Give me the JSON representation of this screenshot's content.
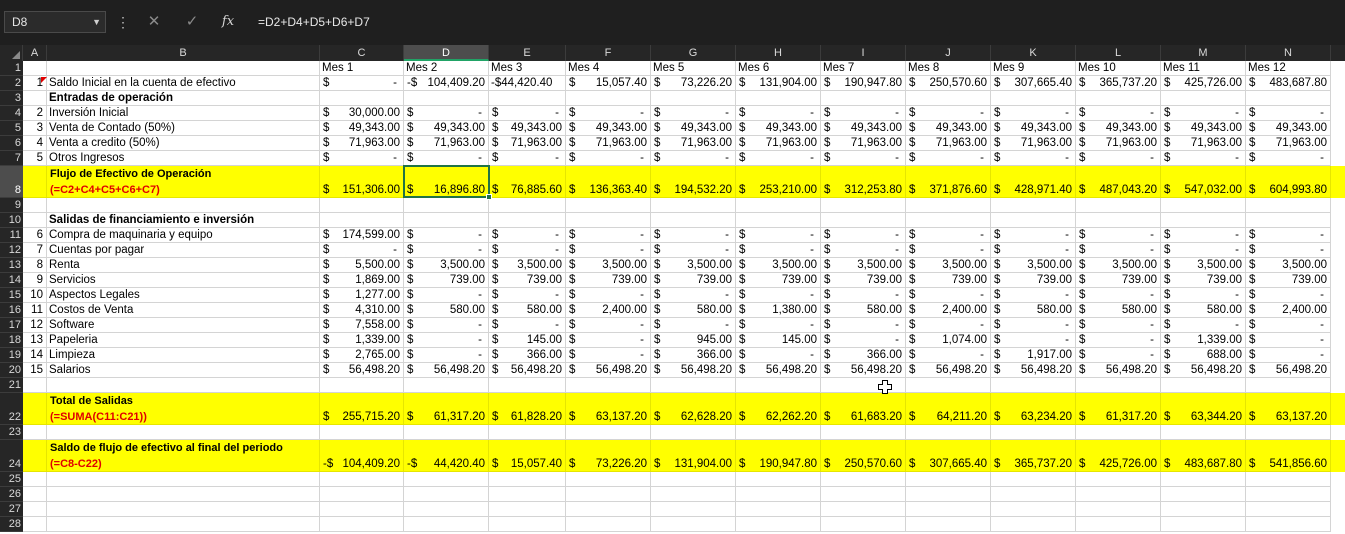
{
  "formula_bar": {
    "name_box": "D8",
    "formula": "=D2+D4+D5+D6+D7"
  },
  "columns": [
    "A",
    "B",
    "C",
    "D",
    "E",
    "F",
    "G",
    "H",
    "I",
    "J",
    "K",
    "L",
    "M",
    "N"
  ],
  "selected_cell": "D8",
  "rows": [
    {
      "n": 1,
      "a": "",
      "b": "",
      "style": "",
      "vals": [
        [
          "",
          "Mes 1"
        ],
        [
          "",
          "Mes 2"
        ],
        [
          "",
          "Mes 3"
        ],
        [
          "",
          "Mes 4"
        ],
        [
          "",
          "Mes 5"
        ],
        [
          "",
          "Mes 6"
        ],
        [
          "",
          "Mes 7"
        ],
        [
          "",
          "Mes 8"
        ],
        [
          "",
          "Mes 9"
        ],
        [
          "",
          "Mes 10"
        ],
        [
          "",
          "Mes 11"
        ],
        [
          "",
          "Mes 12"
        ]
      ]
    },
    {
      "n": 2,
      "a": "1",
      "b": "Saldo Inicial en la cuenta de efectivo",
      "style": "",
      "vals": [
        [
          "$",
          "-"
        ],
        [
          "-$",
          "104,409.20"
        ],
        [
          "-$",
          "44,420.40"
        ],
        [
          "$",
          "15,057.40"
        ],
        [
          "$",
          "73,226.20"
        ],
        [
          "$",
          "131,904.00"
        ],
        [
          "$",
          "190,947.80"
        ],
        [
          "$",
          "250,570.60"
        ],
        [
          "$",
          "307,665.40"
        ],
        [
          "$",
          "365,737.20"
        ],
        [
          "$",
          "425,726.00"
        ],
        [
          "$",
          "483,687.80"
        ]
      ]
    },
    {
      "n": 3,
      "a": "",
      "b": "Entradas de operación",
      "style": "bold",
      "vals": []
    },
    {
      "n": 4,
      "a": "2",
      "b": "Inversión Inicial",
      "style": "",
      "vals": [
        [
          "$",
          "30,000.00"
        ],
        [
          "$",
          "-"
        ],
        [
          "$",
          "-"
        ],
        [
          "$",
          "-"
        ],
        [
          "$",
          "-"
        ],
        [
          "$",
          "-"
        ],
        [
          "$",
          "-"
        ],
        [
          "$",
          "-"
        ],
        [
          "$",
          "-"
        ],
        [
          "$",
          "-"
        ],
        [
          "$",
          "-"
        ],
        [
          "$",
          "-"
        ]
      ]
    },
    {
      "n": 5,
      "a": "3",
      "b": "Venta de Contado (50%)",
      "style": "",
      "vals": [
        [
          "$",
          "49,343.00"
        ],
        [
          "$",
          "49,343.00"
        ],
        [
          "$",
          "49,343.00"
        ],
        [
          "$",
          "49,343.00"
        ],
        [
          "$",
          "49,343.00"
        ],
        [
          "$",
          "49,343.00"
        ],
        [
          "$",
          "49,343.00"
        ],
        [
          "$",
          "49,343.00"
        ],
        [
          "$",
          "49,343.00"
        ],
        [
          "$",
          "49,343.00"
        ],
        [
          "$",
          "49,343.00"
        ],
        [
          "$",
          "49,343.00"
        ]
      ]
    },
    {
      "n": 6,
      "a": "4",
      "b": "Venta a credito (50%)",
      "style": "",
      "vals": [
        [
          "$",
          "71,963.00"
        ],
        [
          "$",
          "71,963.00"
        ],
        [
          "$",
          "71,963.00"
        ],
        [
          "$",
          "71,963.00"
        ],
        [
          "$",
          "71,963.00"
        ],
        [
          "$",
          "71,963.00"
        ],
        [
          "$",
          "71,963.00"
        ],
        [
          "$",
          "71,963.00"
        ],
        [
          "$",
          "71,963.00"
        ],
        [
          "$",
          "71,963.00"
        ],
        [
          "$",
          "71,963.00"
        ],
        [
          "$",
          "71,963.00"
        ]
      ]
    },
    {
      "n": 7,
      "a": "5",
      "b": "Otros Ingresos",
      "style": "",
      "vals": [
        [
          "$",
          "-"
        ],
        [
          "$",
          "-"
        ],
        [
          "$",
          "-"
        ],
        [
          "$",
          "-"
        ],
        [
          "$",
          "-"
        ],
        [
          "$",
          "-"
        ],
        [
          "$",
          "-"
        ],
        [
          "$",
          "-"
        ],
        [
          "$",
          "-"
        ],
        [
          "$",
          "-"
        ],
        [
          "$",
          "-"
        ],
        [
          "$",
          "-"
        ]
      ]
    },
    {
      "n": 8,
      "a": "",
      "b": "Flujo de Efectivo de Operación",
      "b2": "(=C2+C4+C5+C6+C7)",
      "style": "yellow",
      "vals": [
        [
          "$",
          "151,306.00"
        ],
        [
          "$",
          "16,896.80"
        ],
        [
          "$",
          "76,885.60"
        ],
        [
          "$",
          "136,363.40"
        ],
        [
          "$",
          "194,532.20"
        ],
        [
          "$",
          "253,210.00"
        ],
        [
          "$",
          "312,253.80"
        ],
        [
          "$",
          "371,876.60"
        ],
        [
          "$",
          "428,971.40"
        ],
        [
          "$",
          "487,043.20"
        ],
        [
          "$",
          "547,032.00"
        ],
        [
          "$",
          "604,993.80"
        ]
      ]
    },
    {
      "n": 9,
      "a": "",
      "b": "",
      "style": "",
      "vals": []
    },
    {
      "n": 10,
      "a": "",
      "b": "Salidas de financiamiento e inversión",
      "style": "bold",
      "vals": []
    },
    {
      "n": 11,
      "a": "6",
      "b": "Compra de maquinaria y equipo",
      "style": "",
      "vals": [
        [
          "$",
          "174,599.00"
        ],
        [
          "$",
          "-"
        ],
        [
          "$",
          "-"
        ],
        [
          "$",
          "-"
        ],
        [
          "$",
          "-"
        ],
        [
          "$",
          "-"
        ],
        [
          "$",
          "-"
        ],
        [
          "$",
          "-"
        ],
        [
          "$",
          "-"
        ],
        [
          "$",
          "-"
        ],
        [
          "$",
          "-"
        ],
        [
          "$",
          "-"
        ]
      ]
    },
    {
      "n": 12,
      "a": "7",
      "b": "Cuentas por pagar",
      "style": "",
      "vals": [
        [
          "$",
          "-"
        ],
        [
          "$",
          "-"
        ],
        [
          "$",
          "-"
        ],
        [
          "$",
          "-"
        ],
        [
          "$",
          "-"
        ],
        [
          "$",
          "-"
        ],
        [
          "$",
          "-"
        ],
        [
          "$",
          "-"
        ],
        [
          "$",
          "-"
        ],
        [
          "$",
          "-"
        ],
        [
          "$",
          "-"
        ],
        [
          "$",
          "-"
        ]
      ]
    },
    {
      "n": 13,
      "a": "8",
      "b": "Renta",
      "style": "",
      "vals": [
        [
          "$",
          "5,500.00"
        ],
        [
          "$",
          "3,500.00"
        ],
        [
          "$",
          "3,500.00"
        ],
        [
          "$",
          "3,500.00"
        ],
        [
          "$",
          "3,500.00"
        ],
        [
          "$",
          "3,500.00"
        ],
        [
          "$",
          "3,500.00"
        ],
        [
          "$",
          "3,500.00"
        ],
        [
          "$",
          "3,500.00"
        ],
        [
          "$",
          "3,500.00"
        ],
        [
          "$",
          "3,500.00"
        ],
        [
          "$",
          "3,500.00"
        ]
      ]
    },
    {
      "n": 14,
      "a": "9",
      "b": "Servicios",
      "style": "",
      "vals": [
        [
          "$",
          "1,869.00"
        ],
        [
          "$",
          "739.00"
        ],
        [
          "$",
          "739.00"
        ],
        [
          "$",
          "739.00"
        ],
        [
          "$",
          "739.00"
        ],
        [
          "$",
          "739.00"
        ],
        [
          "$",
          "739.00"
        ],
        [
          "$",
          "739.00"
        ],
        [
          "$",
          "739.00"
        ],
        [
          "$",
          "739.00"
        ],
        [
          "$",
          "739.00"
        ],
        [
          "$",
          "739.00"
        ]
      ]
    },
    {
      "n": 15,
      "a": "10",
      "b": "Aspectos Legales",
      "style": "",
      "vals": [
        [
          "$",
          "1,277.00"
        ],
        [
          "$",
          "-"
        ],
        [
          "$",
          "-"
        ],
        [
          "$",
          "-"
        ],
        [
          "$",
          "-"
        ],
        [
          "$",
          "-"
        ],
        [
          "$",
          "-"
        ],
        [
          "$",
          "-"
        ],
        [
          "$",
          "-"
        ],
        [
          "$",
          "-"
        ],
        [
          "$",
          "-"
        ],
        [
          "$",
          "-"
        ]
      ]
    },
    {
      "n": 16,
      "a": "11",
      "b": "Costos de Venta",
      "style": "",
      "vals": [
        [
          "$",
          "4,310.00"
        ],
        [
          "$",
          "580.00"
        ],
        [
          "$",
          "580.00"
        ],
        [
          "$",
          "2,400.00"
        ],
        [
          "$",
          "580.00"
        ],
        [
          "$",
          "1,380.00"
        ],
        [
          "$",
          "580.00"
        ],
        [
          "$",
          "2,400.00"
        ],
        [
          "$",
          "580.00"
        ],
        [
          "$",
          "580.00"
        ],
        [
          "$",
          "580.00"
        ],
        [
          "$",
          "2,400.00"
        ]
      ]
    },
    {
      "n": 17,
      "a": "12",
      "b": "Software",
      "style": "",
      "vals": [
        [
          "$",
          "7,558.00"
        ],
        [
          "$",
          "-"
        ],
        [
          "$",
          "-"
        ],
        [
          "$",
          "-"
        ],
        [
          "$",
          "-"
        ],
        [
          "$",
          "-"
        ],
        [
          "$",
          "-"
        ],
        [
          "$",
          "-"
        ],
        [
          "$",
          "-"
        ],
        [
          "$",
          "-"
        ],
        [
          "$",
          "-"
        ],
        [
          "$",
          "-"
        ]
      ]
    },
    {
      "n": 18,
      "a": "13",
      "b": "Papeleria",
      "style": "",
      "vals": [
        [
          "$",
          "1,339.00"
        ],
        [
          "$",
          "-"
        ],
        [
          "$",
          "145.00"
        ],
        [
          "$",
          "-"
        ],
        [
          "$",
          "945.00"
        ],
        [
          "$",
          "145.00"
        ],
        [
          "$",
          "-"
        ],
        [
          "$",
          "1,074.00"
        ],
        [
          "$",
          "-"
        ],
        [
          "$",
          "-"
        ],
        [
          "$",
          "1,339.00"
        ],
        [
          "$",
          "-"
        ]
      ]
    },
    {
      "n": 19,
      "a": "14",
      "b": "Limpieza",
      "style": "",
      "vals": [
        [
          "$",
          "2,765.00"
        ],
        [
          "$",
          "-"
        ],
        [
          "$",
          "366.00"
        ],
        [
          "$",
          "-"
        ],
        [
          "$",
          "366.00"
        ],
        [
          "$",
          "-"
        ],
        [
          "$",
          "366.00"
        ],
        [
          "$",
          "-"
        ],
        [
          "$",
          "1,917.00"
        ],
        [
          "$",
          "-"
        ],
        [
          "$",
          "688.00"
        ],
        [
          "$",
          "-"
        ]
      ]
    },
    {
      "n": 20,
      "a": "15",
      "b": "Salarios",
      "style": "",
      "vals": [
        [
          "$",
          "56,498.20"
        ],
        [
          "$",
          "56,498.20"
        ],
        [
          "$",
          "56,498.20"
        ],
        [
          "$",
          "56,498.20"
        ],
        [
          "$",
          "56,498.20"
        ],
        [
          "$",
          "56,498.20"
        ],
        [
          "$",
          "56,498.20"
        ],
        [
          "$",
          "56,498.20"
        ],
        [
          "$",
          "56,498.20"
        ],
        [
          "$",
          "56,498.20"
        ],
        [
          "$",
          "56,498.20"
        ],
        [
          "$",
          "56,498.20"
        ]
      ]
    },
    {
      "n": 21,
      "a": "",
      "b": "",
      "style": "",
      "vals": []
    },
    {
      "n": 22,
      "a": "",
      "b": "Total de Salidas",
      "b2": "(=SUMA(C11:C21))",
      "style": "yellow",
      "vals": [
        [
          "$",
          "255,715.20"
        ],
        [
          "$",
          "61,317.20"
        ],
        [
          "$",
          "61,828.20"
        ],
        [
          "$",
          "63,137.20"
        ],
        [
          "$",
          "62,628.20"
        ],
        [
          "$",
          "62,262.20"
        ],
        [
          "$",
          "61,683.20"
        ],
        [
          "$",
          "64,211.20"
        ],
        [
          "$",
          "63,234.20"
        ],
        [
          "$",
          "61,317.20"
        ],
        [
          "$",
          "63,344.20"
        ],
        [
          "$",
          "63,137.20"
        ]
      ]
    },
    {
      "n": 23,
      "a": "",
      "b": "",
      "style": "",
      "vals": []
    },
    {
      "n": 24,
      "a": "",
      "b": "Saldo de flujo de efectivo al final del periodo",
      "b2": "(=C8-C22)",
      "style": "yellow",
      "vals": [
        [
          "-$",
          "104,409.20"
        ],
        [
          "-$",
          "44,420.40"
        ],
        [
          "$",
          "15,057.40"
        ],
        [
          "$",
          "73,226.20"
        ],
        [
          "$",
          "131,904.00"
        ],
        [
          "$",
          "190,947.80"
        ],
        [
          "$",
          "250,570.60"
        ],
        [
          "$",
          "307,665.40"
        ],
        [
          "$",
          "365,737.20"
        ],
        [
          "$",
          "425,726.00"
        ],
        [
          "$",
          "483,687.80"
        ],
        [
          "$",
          "541,856.60"
        ]
      ]
    },
    {
      "n": 25,
      "a": "",
      "b": "",
      "style": "",
      "vals": []
    },
    {
      "n": 26,
      "a": "",
      "b": "",
      "style": "",
      "vals": []
    },
    {
      "n": 27,
      "a": "",
      "b": "",
      "style": "",
      "vals": []
    },
    {
      "n": 28,
      "a": "",
      "b": "",
      "style": "",
      "vals": []
    }
  ]
}
